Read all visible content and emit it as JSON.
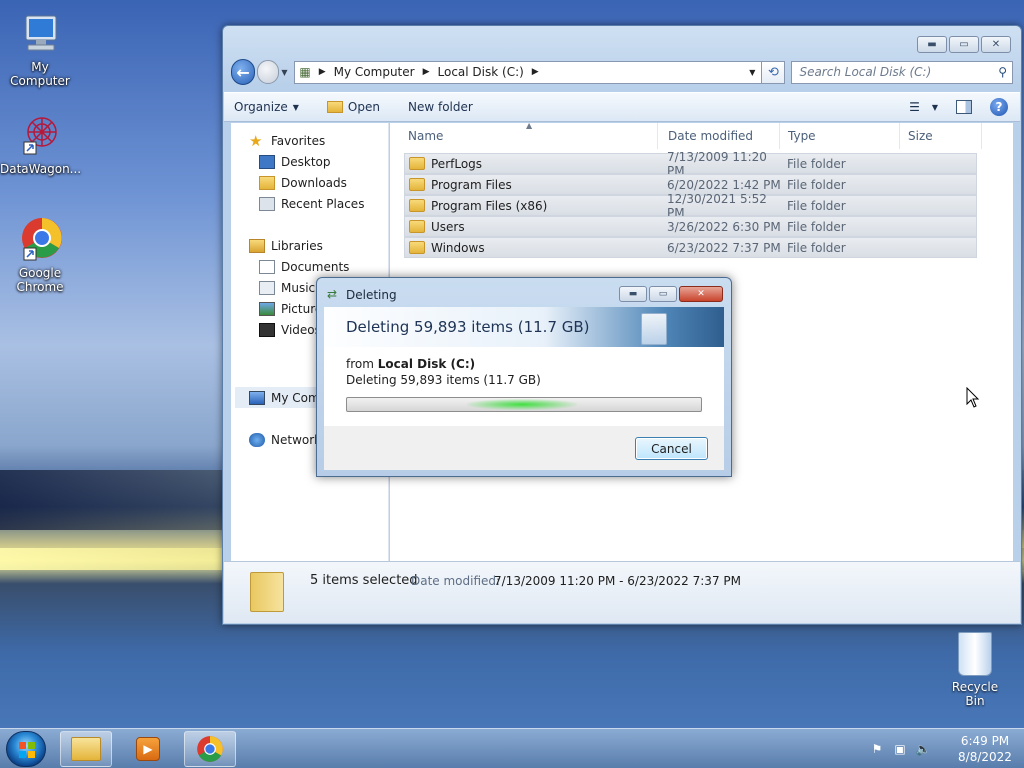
{
  "desktop": {
    "icons": [
      {
        "label": "My Computer"
      },
      {
        "label": "DataWagon..."
      },
      {
        "label": "Google Chrome"
      }
    ],
    "recycle_bin": "Recycle Bin"
  },
  "explorer": {
    "address": {
      "crumbs": [
        "My Computer",
        "Local Disk (C:)"
      ]
    },
    "search_placeholder": "Search Local Disk (C:)",
    "toolbar": {
      "organize": "Organize",
      "open": "Open",
      "new_folder": "New folder"
    },
    "nav": {
      "favorites": "Favorites",
      "desktop": "Desktop",
      "downloads": "Downloads",
      "recent_places": "Recent Places",
      "libraries": "Libraries",
      "documents": "Documents",
      "music": "Music",
      "pictures": "Pictures",
      "videos": "Videos",
      "my_computer": "My Computer",
      "network": "Network"
    },
    "columns": {
      "name": "Name",
      "date": "Date modified",
      "type": "Type",
      "size": "Size"
    },
    "files": [
      {
        "name": "PerfLogs",
        "date": "7/13/2009 11:20 PM",
        "type": "File folder"
      },
      {
        "name": "Program Files",
        "date": "6/20/2022 1:42 PM",
        "type": "File folder"
      },
      {
        "name": "Program Files (x86)",
        "date": "12/30/2021 5:52 PM",
        "type": "File folder"
      },
      {
        "name": "Users",
        "date": "3/26/2022 6:30 PM",
        "type": "File folder"
      },
      {
        "name": "Windows",
        "date": "6/23/2022 7:37 PM",
        "type": "File folder"
      }
    ],
    "details": {
      "selected": "5 items selected",
      "date_label": "Date modified:",
      "date_value": "7/13/2009 11:20 PM - 6/23/2022 7:37 PM"
    }
  },
  "dialog": {
    "title": "Deleting",
    "banner": "Deleting 59,893 items (11.7 GB)",
    "from_prefix": "from",
    "from_location": "Local Disk (C:)",
    "detail": "Deleting 59,893 items (11.7 GB)",
    "progress_state": "indeterminate",
    "cancel": "Cancel"
  },
  "taskbar": {
    "time": "6:49 PM",
    "date": "8/8/2022"
  }
}
